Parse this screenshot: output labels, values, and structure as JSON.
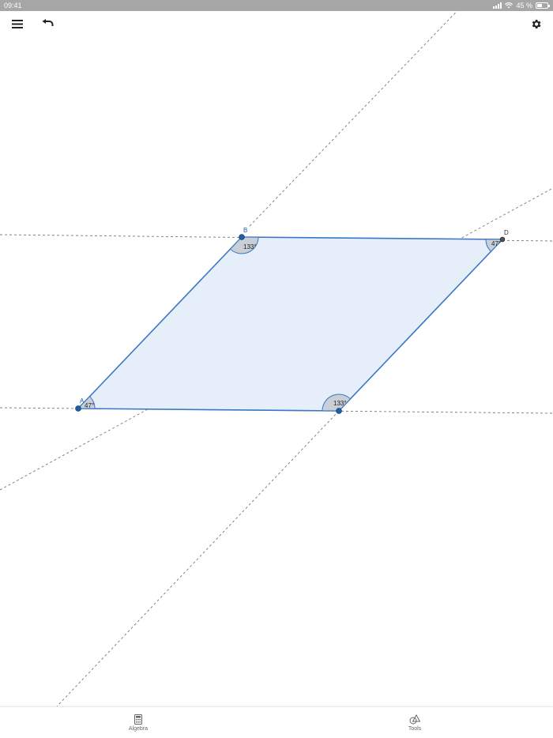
{
  "status_bar": {
    "time": "09:41",
    "battery_text": "45 %",
    "battery_level": 0.45
  },
  "toolbar": {
    "menu_icon": "hamburger-menu-icon",
    "undo_icon": "undo-icon",
    "settings_icon": "gear-icon"
  },
  "geometry": {
    "points": {
      "A": "A",
      "B": "B",
      "C": "",
      "D": "D"
    },
    "angles": {
      "A": "47°",
      "B": "133°",
      "C": "133°",
      "D": "47°"
    },
    "colors": {
      "polygon_fill": "#e6eef9",
      "polygon_stroke": "#3a77c4",
      "point": "#1f5fa8",
      "angle_fill": "#c9cfd6",
      "guide_line": "#777777"
    }
  },
  "bottom_nav": {
    "tabs": [
      {
        "label": "Algebra",
        "icon": "calculator-icon"
      },
      {
        "label": "Tools",
        "icon": "shapes-icon"
      }
    ]
  }
}
